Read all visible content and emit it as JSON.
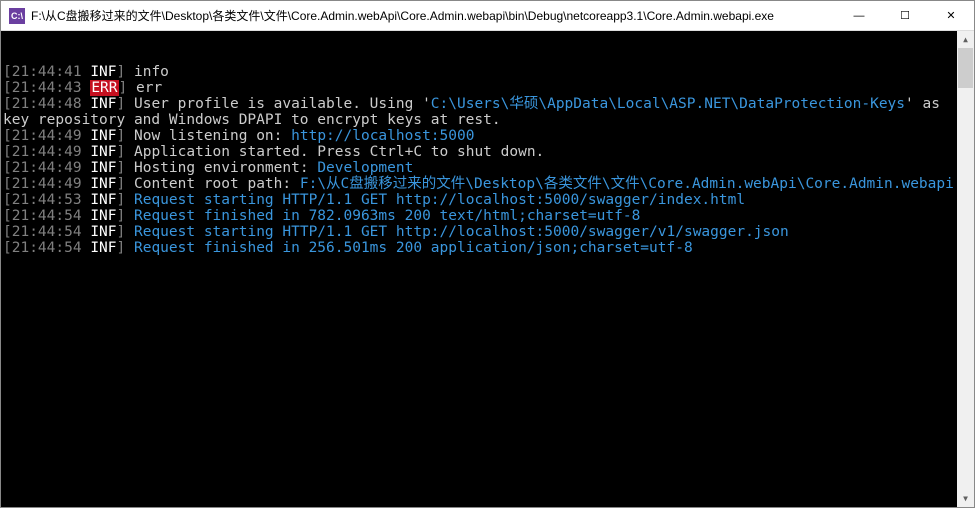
{
  "window": {
    "icon_text": "C:\\",
    "title": "F:\\从C盘搬移过来的文件\\Desktop\\各类文件\\文件\\Core.Admin.webApi\\Core.Admin.webapi\\bin\\Debug\\netcoreapp3.1\\Core.Admin.webapi.exe",
    "minimize": "—",
    "maximize": "☐",
    "close": "✕"
  },
  "scrollbar": {
    "up": "▲",
    "down": "▼"
  },
  "lines": [
    {
      "ts": "21:44:41",
      "level": "INF",
      "segs": [
        {
          "t": "white",
          "v": "info"
        }
      ]
    },
    {
      "ts": "21:44:43",
      "level": "ERR",
      "segs": [
        {
          "t": "white",
          "v": "err"
        }
      ]
    },
    {
      "ts": "21:44:48",
      "level": "INF",
      "segs": [
        {
          "t": "white",
          "v": "User profile is available. Using '"
        },
        {
          "t": "cyan",
          "v": "C:\\Users\\华硕\\AppData\\Local\\ASP.NET\\DataProtection-Keys"
        },
        {
          "t": "white",
          "v": "' as key repository and Windows DPAPI to encrypt keys at rest."
        }
      ]
    },
    {
      "ts": "21:44:49",
      "level": "INF",
      "segs": [
        {
          "t": "white",
          "v": "Now listening on: "
        },
        {
          "t": "cyan",
          "v": "http://localhost:5000"
        }
      ]
    },
    {
      "ts": "21:44:49",
      "level": "INF",
      "segs": [
        {
          "t": "white",
          "v": "Application started. Press Ctrl+C to shut down."
        }
      ]
    },
    {
      "ts": "21:44:49",
      "level": "INF",
      "segs": [
        {
          "t": "white",
          "v": "Hosting environment: "
        },
        {
          "t": "cyan",
          "v": "Development"
        }
      ]
    },
    {
      "ts": "21:44:49",
      "level": "INF",
      "segs": [
        {
          "t": "white",
          "v": "Content root path: "
        },
        {
          "t": "cyan",
          "v": "F:\\从C盘搬移过来的文件\\Desktop\\各类文件\\文件\\Core.Admin.webApi\\Core.Admin.webapi"
        }
      ]
    },
    {
      "ts": "21:44:53",
      "level": "INF",
      "segs": [
        {
          "t": "cyan",
          "v": "Request starting HTTP/1.1 GET http://localhost:5000/swagger/index.html"
        }
      ]
    },
    {
      "ts": "21:44:54",
      "level": "INF",
      "segs": [
        {
          "t": "cyan",
          "v": "Request finished in 782.0963ms 200 text/html;charset=utf-8"
        }
      ]
    },
    {
      "ts": "21:44:54",
      "level": "INF",
      "segs": [
        {
          "t": "cyan",
          "v": "Request starting HTTP/1.1 GET http://localhost:5000/swagger/v1/swagger.json"
        }
      ]
    },
    {
      "ts": "21:44:54",
      "level": "INF",
      "segs": [
        {
          "t": "cyan",
          "v": "Request finished in 256.501ms 200 application/json;charset=utf-8"
        }
      ]
    }
  ]
}
